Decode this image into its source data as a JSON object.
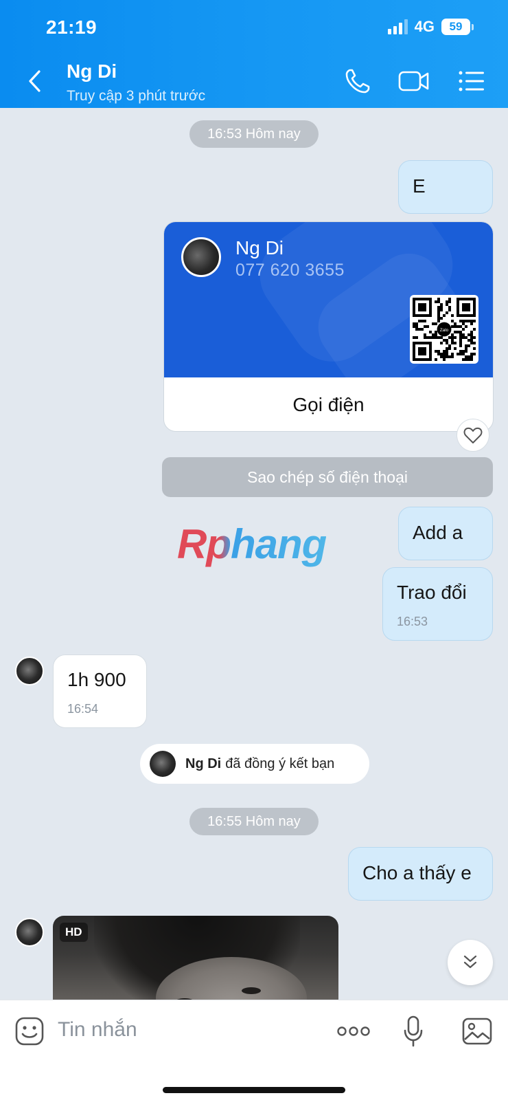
{
  "status_bar": {
    "time": "21:19",
    "network": "4G",
    "battery": "59"
  },
  "header": {
    "title": "Ng Di",
    "subtitle": "Truy cập 3 phút trước"
  },
  "chat": {
    "time_divider_1": "16:53 Hôm nay",
    "msg_e": "E",
    "contact_card": {
      "name": "Ng Di",
      "phone": "077 620 3655",
      "qr_label": "Zalo",
      "call_label": "Gọi điện"
    },
    "copy_phone_label": "Sao chép số điện thoại",
    "watermark": "Rphang",
    "msg_add": "Add a",
    "msg_trao": {
      "text": "Trao đổi",
      "time": "16:53"
    },
    "msg_in_1": {
      "text": "1h 900",
      "time": "16:54"
    },
    "friend_notice": {
      "name": "Ng Di",
      "text": "đã đồng ý kết bạn"
    },
    "time_divider_2": "16:55 Hôm nay",
    "msg_cho": "Cho a thấy e",
    "photo_badge": "HD"
  },
  "input": {
    "placeholder": "Tin nhắn"
  },
  "colors": {
    "header_blue": "#1597f3",
    "card_blue": "#1a5ed8",
    "bubble_out": "#d4ebfb",
    "chat_bg": "#e2e8ef"
  }
}
